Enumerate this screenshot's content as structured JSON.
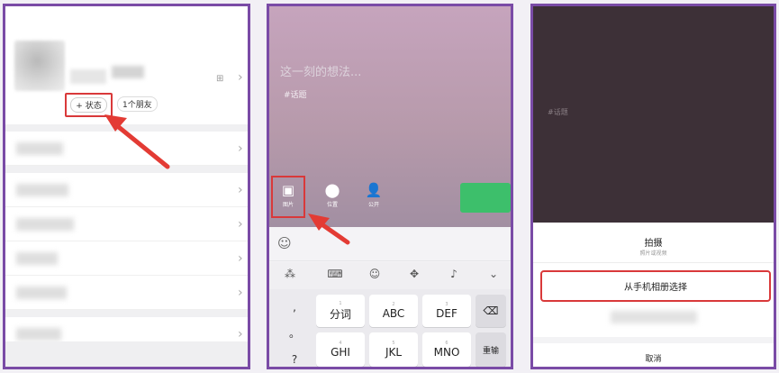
{
  "colors": {
    "highlight_border": "#d9393a",
    "arrow": "#e33b34",
    "send_button": "#3dbf6b",
    "frame": "#7a4ba6"
  },
  "panel1": {
    "status_button": "+ 状态",
    "friends_pill": "1个朋友",
    "qr_icon": "qr-code-icon"
  },
  "panel2": {
    "placeholder": "这一刻的想法...",
    "topic_tag": "#话题",
    "tools": {
      "photo_label": "图片",
      "location_label": "位置",
      "visibility_label": "公开"
    },
    "keyboard": {
      "punct": [
        ",",
        "。",
        "?"
      ],
      "row1": [
        {
          "num": "1",
          "label": "分词"
        },
        {
          "num": "2",
          "label": "ABC"
        },
        {
          "num": "3",
          "label": "DEF"
        }
      ],
      "row2": [
        {
          "num": "4",
          "label": "GHI"
        },
        {
          "num": "5",
          "label": "JKL"
        },
        {
          "num": "6",
          "label": "MNO"
        }
      ],
      "delete_icon": "backspace-icon",
      "reset_label": "重输"
    }
  },
  "panel3": {
    "topic_tag": "#话题",
    "sheet_title": "拍摄",
    "sheet_subtitle": "照片或视频",
    "album_option": "从手机相册选择",
    "cancel": "取消"
  }
}
